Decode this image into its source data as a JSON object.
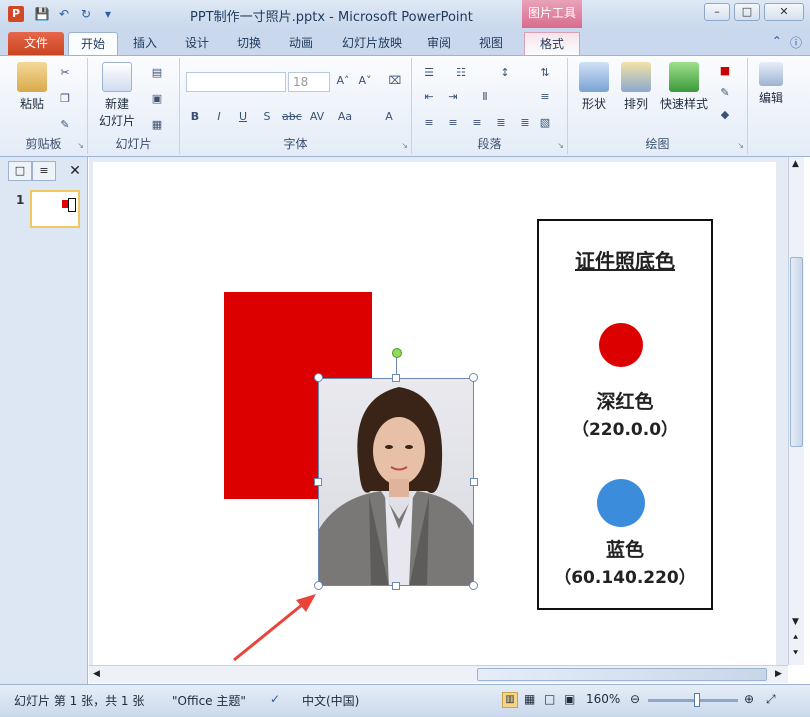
{
  "window": {
    "title": "PPT制作一寸照片.pptx - Microsoft PowerPoint",
    "app_icon": "P",
    "context_tool": "图片工具"
  },
  "tabs": [
    "文件",
    "开始",
    "插入",
    "设计",
    "切换",
    "动画",
    "幻灯片放映",
    "审阅",
    "视图",
    "格式"
  ],
  "ribbon": {
    "clipboard": {
      "paste": "粘贴",
      "label": "剪贴板"
    },
    "slides": {
      "new_slide_line1": "新建",
      "new_slide_line2": "幻灯片",
      "label": "幻灯片"
    },
    "font": {
      "size_value": "18",
      "label": "字体"
    },
    "paragraph": {
      "label": "段落"
    },
    "drawing": {
      "shapes": "形状",
      "arrange": "排列",
      "quick_styles": "快速样式",
      "label": "绘图"
    },
    "editing": {
      "edit": "编辑"
    }
  },
  "left_pane": {
    "slide_number": "1"
  },
  "slide": {
    "panel_title": "证件照底色",
    "colors": [
      {
        "name": "深红色",
        "value": "（220.0.0）",
        "hex": "#dc0000"
      },
      {
        "name": "蓝色",
        "value": "（60.140.220）",
        "hex": "#3c8cdc"
      }
    ]
  },
  "status": {
    "slide_info": "幻灯片 第 1 张，共 1 张",
    "theme": "\"Office 主题\"",
    "language": "中文(中国)",
    "zoom": "160%"
  },
  "colors": {
    "accent_file_tab": "#d24726",
    "ribbon_bg": "#e4ecf7"
  }
}
